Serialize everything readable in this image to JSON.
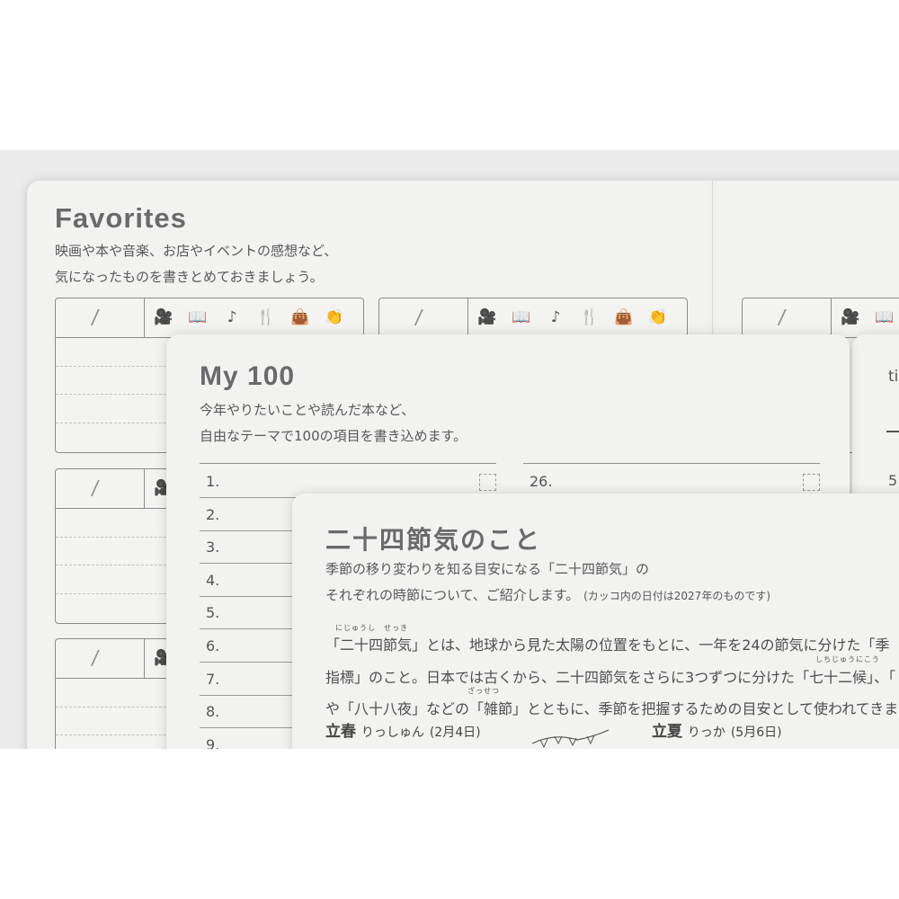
{
  "favorites": {
    "title": "Favorites",
    "desc_line1": "映画や本や音楽、お店やイベントの感想など、",
    "desc_line2": "気になったものを書きとめておきましょう。",
    "date_slash": "/",
    "icons": [
      {
        "name": "movie-camera-icon",
        "glyph": "🎥"
      },
      {
        "name": "book-icon",
        "glyph": "📖"
      },
      {
        "name": "music-note-icon",
        "glyph": "♪"
      },
      {
        "name": "fork-knife-icon",
        "glyph": "🍴"
      },
      {
        "name": "shopping-bag-icon",
        "glyph": "👜"
      },
      {
        "name": "clapping-hands-icon",
        "glyph": "👏"
      }
    ]
  },
  "my100": {
    "title": "My 100",
    "desc_line1": "今年やりたいことや読んだ本など、",
    "desc_line2": "自由なテーマで100の項目を書き込めます。",
    "left_numbers": [
      "1.",
      "2.",
      "3.",
      "4.",
      "5.",
      "6.",
      "7.",
      "8.",
      "9."
    ],
    "right_numbers": [
      "26."
    ]
  },
  "peek_page": {
    "text_fragment": "ti",
    "number_fragment": "5"
  },
  "sekki": {
    "title": "二十四節気のこと",
    "desc_line1": "季節の移り変わりを知る目安になる「二十四節気」の",
    "desc_line2": "それぞれの時節について、ご紹介します。",
    "desc_note": "(カッコ内の日付は2027年のものです)",
    "ruby1": "にじゅうし　せっき",
    "body_line1": "「二十四節気」とは、地球から見た太陽の位置をもとに、一年を24の節気に分けた「季",
    "ruby2": "しちじゅうにこう",
    "body_line2": "指標」のこと。日本では古くから、二十四節気をさらに3つずつに分けた「七十二候」、「",
    "ruby3": "ざっせつ",
    "body_line3": "や「八十八夜」などの「雑節」とともに、季節を把握するための目安として使われてきま",
    "season1_name": "立春",
    "season1_reading": "りっしゅん",
    "season1_date": "(2月4日)",
    "season2_name": "立夏",
    "season2_reading": "りっか",
    "season2_date": "(5月6日)"
  }
}
